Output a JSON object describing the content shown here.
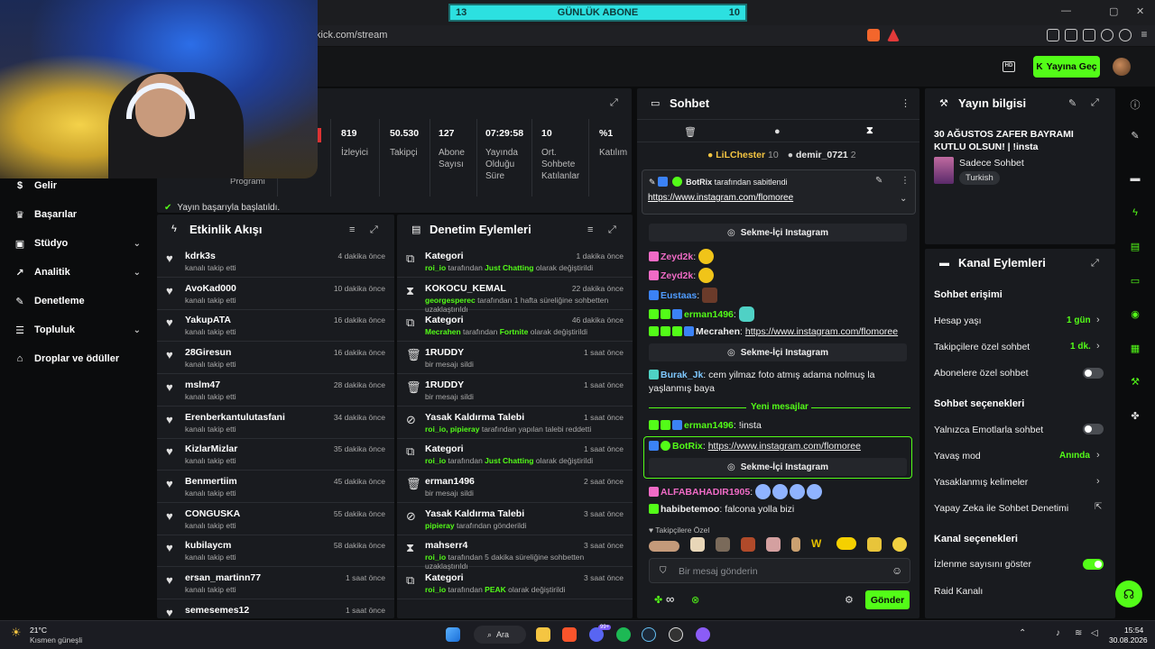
{
  "browser": {
    "url": "kick.com/stream",
    "goal_widget": {
      "left": "13",
      "title": "GÜNLÜK ABONE",
      "right": "10"
    }
  },
  "header": {
    "go_live": "Yayına Geç",
    "badge": "HD"
  },
  "nav": {
    "items": [
      {
        "label": "Gelir",
        "icon": "money-icon"
      },
      {
        "label": "Başarılar",
        "icon": "trophy-icon"
      },
      {
        "label": "Stüdyo",
        "icon": "studio-icon"
      },
      {
        "label": "Analitik",
        "icon": "chart-icon"
      },
      {
        "label": "Denetleme",
        "icon": "wrench-icon"
      },
      {
        "label": "Topluluk",
        "icon": "community-icon"
      },
      {
        "label": "Droplar ve ödüller",
        "icon": "gift-icon"
      }
    ],
    "partial_label": "Programı"
  },
  "stats": {
    "items": [
      {
        "value": "819",
        "label": "İzleyici"
      },
      {
        "value": "50.530",
        "label": "Takipçi"
      },
      {
        "value": "127",
        "label": "Abone Sayısı"
      },
      {
        "value": "07:29:58",
        "label": "Yayında Olduğu Süre"
      },
      {
        "value": "10",
        "label": "Ort. Sohbete Katılanlar"
      },
      {
        "value": "%1",
        "label": "Katılım"
      }
    ],
    "notice": "Yayın başarıyla başlatıldı."
  },
  "activity": {
    "title": "Etkinlik Akışı",
    "rows": [
      {
        "name": "kdrk3s",
        "sub": "kanalı takip etti",
        "time": "4 dakika önce"
      },
      {
        "name": "AvoKad000",
        "sub": "kanalı takip etti",
        "time": "10 dakika önce"
      },
      {
        "name": "YakupATA",
        "sub": "kanalı takip etti",
        "time": "16 dakika önce"
      },
      {
        "name": "28Giresun",
        "sub": "kanalı takip etti",
        "time": "16 dakika önce"
      },
      {
        "name": "mslm47",
        "sub": "kanalı takip etti",
        "time": "28 dakika önce"
      },
      {
        "name": "Erenberkantulutasfani",
        "sub": "kanalı takip etti",
        "time": "34 dakika önce"
      },
      {
        "name": "KizlarMizlar",
        "sub": "kanalı takip etti",
        "time": "35 dakika önce"
      },
      {
        "name": "Benmertiim",
        "sub": "kanalı takip etti",
        "time": "45 dakika önce"
      },
      {
        "name": "CONGUSKA",
        "sub": "kanalı takip etti",
        "time": "55 dakika önce"
      },
      {
        "name": "kubilaycm",
        "sub": "kanalı takip etti",
        "time": "58 dakika önce"
      },
      {
        "name": "ersan_martinn77",
        "sub": "kanalı takip etti",
        "time": "1 saat önce"
      },
      {
        "name": "semesemes12",
        "sub": "kanalı takip etti",
        "time": "1 saat önce"
      }
    ]
  },
  "moderation": {
    "title": "Denetim Eylemleri",
    "rows": [
      {
        "icon": "category-icon",
        "name": "Kategori",
        "actor": "roi_io",
        "text": " tarafından ",
        "hl": "Just Chatting",
        "text2": " olarak değiştirildi",
        "time": "1 dakika önce"
      },
      {
        "icon": "hourglass-icon",
        "name": "KOKOCU_KEMAL",
        "actor": "georgesperec",
        "text": " tarafından 1 hafta süreliğine sohbetten uzaklaştırıldı",
        "hl": "",
        "text2": "",
        "time": "22 dakika önce"
      },
      {
        "icon": "category-icon",
        "name": "Kategori",
        "actor": "Mecrahen",
        "text": " tarafından ",
        "hl": "Fortnite",
        "text2": " olarak değiştirildi",
        "time": "46 dakika önce"
      },
      {
        "icon": "trash-icon",
        "name": "1RUDDY",
        "actor": "",
        "text": "bir mesajı sildi",
        "hl": "",
        "text2": "",
        "time": "1 saat önce"
      },
      {
        "icon": "trash-icon",
        "name": "1RUDDY",
        "actor": "",
        "text": "bir mesajı sildi",
        "hl": "",
        "text2": "",
        "time": "1 saat önce"
      },
      {
        "icon": "unban-icon",
        "name": "Yasak Kaldırma Talebi",
        "actor": "roi_io, pipieray",
        "text": " tarafından yapılan talebi reddetti",
        "hl": "",
        "text2": "",
        "time": "1 saat önce"
      },
      {
        "icon": "category-icon",
        "name": "Kategori",
        "actor": "roi_io",
        "text": " tarafından ",
        "hl": "Just Chatting",
        "text2": " olarak değiştirildi",
        "time": "1 saat önce"
      },
      {
        "icon": "trash-icon",
        "name": "erman1496",
        "actor": "",
        "text": "bir mesajı sildi",
        "hl": "",
        "text2": "",
        "time": "2 saat önce"
      },
      {
        "icon": "unban-icon",
        "name": "Yasak Kaldırma Talebi",
        "actor": "pipieray",
        "text": " tarafından gönderildi",
        "hl": "",
        "text2": "",
        "time": "3 saat önce"
      },
      {
        "icon": "hourglass-icon",
        "name": "mahserr4",
        "actor": "roi_io",
        "text": " tarafından 5 dakika süreliğine sohbetten uzaklaştırıldı",
        "hl": "",
        "text2": "",
        "time": "3 saat önce"
      },
      {
        "icon": "category-icon",
        "name": "Kategori",
        "actor": "roi_io",
        "text": " tarafından ",
        "hl": "PEAK",
        "text2": " olarak değiştirildi",
        "time": "3 saat önce"
      }
    ]
  },
  "chat": {
    "title": "Sohbet",
    "top_gifters": [
      {
        "name": "LiLChester",
        "count": "10"
      },
      {
        "name": "demir_0721",
        "count": "2"
      }
    ],
    "pinned": {
      "by": "BotRix",
      "by_text": "tarafından sabitlendi",
      "link": "https://www.instagram.com/flomoree"
    },
    "insta_button": "Sekme-İçi Instagram",
    "messages": [
      {
        "user": "Zeyd2k",
        "color": "#f06bc6",
        "text": ""
      },
      {
        "user": "Zeyd2k",
        "color": "#f06bc6",
        "text": ""
      },
      {
        "user": "Eustaas",
        "color": "#4f9cff",
        "text": ""
      },
      {
        "user": "erman1496",
        "color": "#53fc18",
        "text": ""
      },
      {
        "user": "Mecrahen",
        "color": "#ffffff",
        "text": "https://www.instagram.com/flomoree"
      },
      {
        "user": "Burak_Jk",
        "color": "#7ec8ff",
        "text": "cem yilmaz foto atmış adama nolmuş la yaşlanmış baya"
      },
      {
        "user": "erman1496",
        "color": "#53fc18",
        "text": "!insta"
      },
      {
        "user": "BotRix",
        "color": "#53fc18",
        "text": "https://www.instagram.com/flomoree"
      },
      {
        "user": "ALFABAHADIR1905",
        "color": "#f06bc6",
        "text": ""
      },
      {
        "user": "habibetemoo",
        "color": "#ffffff",
        "text": "falcona yolla bizi"
      }
    ],
    "new_messages": "Yeni mesajlar",
    "followers_only": "Takipçilere Özel",
    "placeholder": "Bir mesaj gönderin",
    "send": "Gönder",
    "infinity": "∞"
  },
  "stream_info": {
    "title": "Yayın bilgisi",
    "stream_title": "30 AĞUSTOS ZAFER BAYRAMI KUTLU OLSUN! | !insta",
    "category": "Sadece Sohbet",
    "tag": "Turkish"
  },
  "channel_actions": {
    "title": "Kanal Eylemleri",
    "chat_access": "Sohbet erişimi",
    "account_age": {
      "label": "Hesap yaşı",
      "value": "1 gün"
    },
    "followers_chat": {
      "label": "Takipçilere özel sohbet",
      "value": "1 dk."
    },
    "subs_chat": {
      "label": "Abonelere özel sohbet",
      "on": false
    },
    "chat_options": "Sohbet seçenekleri",
    "emote_only": {
      "label": "Yalnızca Emotlarla sohbet",
      "on": false
    },
    "slow_mode": {
      "label": "Yavaş mod",
      "value": "Anında"
    },
    "banned_words": "Yasaklanmış kelimeler",
    "ai_moderation": "Yapay Zeka ile Sohbet Denetimi",
    "channel_options": "Kanal seçenekleri",
    "show_viewers": {
      "label": "İzlenme sayısını göster",
      "on": true
    },
    "raid": "Raid Kanalı"
  },
  "taskbar": {
    "temp": "21°C",
    "weather": "Kısmen güneşli",
    "search": "Ara",
    "time": "15:54",
    "date": "30.08.2026",
    "notif": "99+"
  },
  "colors": {
    "accent": "#53fc18",
    "panel": "#191b1f",
    "bg": "#0b0c0d"
  }
}
